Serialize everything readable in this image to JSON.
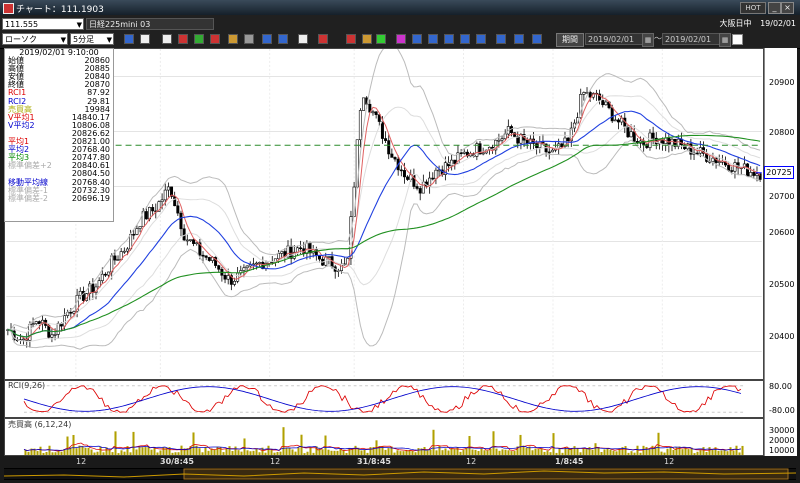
{
  "window": {
    "title": "チャート：111.1903",
    "hot_label": "HOT",
    "session": "大阪日中",
    "session_date": "19/02/01"
  },
  "toolbar": {
    "symbol_code": "111.555",
    "symbol_name": "日経225mini 03",
    "chart_type": "ローソク",
    "interval": "5分足",
    "period_label": "期間",
    "date_from": "2019/02/01",
    "date_to": "2019/02/01",
    "date_sep": "～"
  },
  "databox": {
    "timestamp": "2019/02/01 9:10:00",
    "rows": [
      {
        "k": "始値",
        "v": "20860",
        "c": "#000"
      },
      {
        "k": "高値",
        "v": "20885",
        "c": "#000"
      },
      {
        "k": "安値",
        "v": "20840",
        "c": "#000"
      },
      {
        "k": "終値",
        "v": "20870",
        "c": "#000"
      },
      {
        "k": "RCI1",
        "v": "87.92",
        "c": "#d00"
      },
      {
        "k": "RCI2",
        "v": "29.81",
        "c": "#00c"
      },
      {
        "k": "売買高",
        "v": "19984",
        "c": "#aa0"
      },
      {
        "k": "V平均1",
        "v": "14840.17",
        "c": "#d00"
      },
      {
        "k": "V平均2",
        "v": "10806.08",
        "c": "#00c"
      },
      {
        "k": "",
        "v": "20826.62",
        "c": "#999"
      },
      {
        "k": "平均1",
        "v": "20821.00",
        "c": "#d00"
      },
      {
        "k": "平均2",
        "v": "20768.40",
        "c": "#00c"
      },
      {
        "k": "平均3",
        "v": "20747.80",
        "c": "#080"
      },
      {
        "k": "標準偏差+2",
        "v": "20840.61",
        "c": "#aaa"
      },
      {
        "k": "",
        "v": "20804.50",
        "c": "#aaa"
      },
      {
        "k": "移動平均線",
        "v": "20768.40",
        "c": "#00c"
      },
      {
        "k": "標準偏差-1",
        "v": "20732.30",
        "c": "#aaa"
      },
      {
        "k": "標準偏差-2",
        "v": "20696.19",
        "c": "#aaa"
      }
    ]
  },
  "price_axis": {
    "ticks": [
      "20900",
      "20800",
      "20700",
      "20600",
      "20500",
      "20400"
    ],
    "current": "20725"
  },
  "rci_panel": {
    "label": "RCI(9,26)",
    "ticks": [
      "80.00",
      "-80.00"
    ]
  },
  "vol_panel": {
    "label": "売買高 (6,12,24)",
    "ticks": [
      "30000",
      "20000",
      "10000"
    ]
  },
  "time_axis": [
    "12",
    "30/8:45",
    "12",
    "31/8:45",
    "12",
    "1/8:45",
    "12"
  ],
  "chart_data": {
    "type": "candlestick",
    "instrument": "日経225mini 03",
    "interval": "5分足",
    "ylim": [
      20350,
      20950
    ],
    "close_path_approx": [
      20440,
      20420,
      20460,
      20430,
      20470,
      20500,
      20520,
      20560,
      20590,
      20640,
      20660,
      20700,
      20610,
      20580,
      20560,
      20530,
      20540,
      20560,
      20570,
      20580,
      20590,
      20570,
      20560,
      20550,
      20880,
      20820,
      20760,
      20720,
      20700,
      20730,
      20740,
      20760,
      20770,
      20780,
      20800,
      20780,
      20770,
      20760,
      20780,
      20870,
      20860,
      20830,
      20800,
      20780,
      20790,
      20780,
      20770,
      20760,
      20750,
      20740,
      20730,
      20725
    ]
  }
}
